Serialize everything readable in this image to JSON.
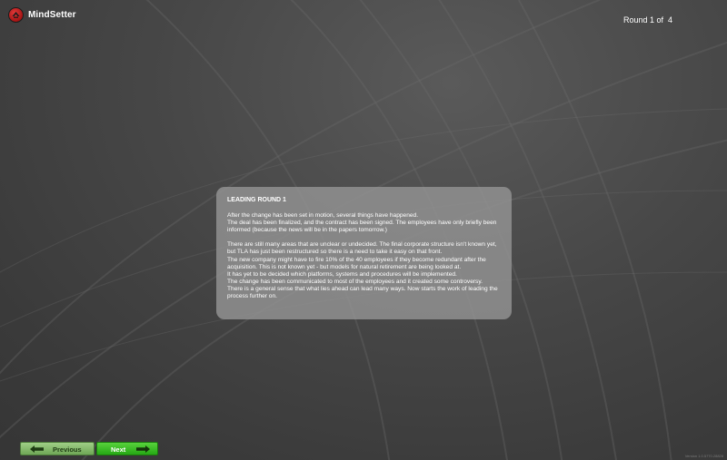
{
  "app": {
    "name": "MindSetter",
    "icon": "mindsetter-logo-icon"
  },
  "round": {
    "text": "Round 1 of  4"
  },
  "panel": {
    "title": "LEADING ROUND 1",
    "para1": "After the change has been set in motion, several things have happened.\nThe deal has been finalized, and the contract has been signed. The employees have only briefly been informed (because the news will be in the papers tomorrow.)",
    "para2": "There are still many areas that are unclear or undecided. The final corporate structure isn't known yet, but TLA has just been restructured so there is a need to take it easy on that front.\nThe new company might have to fire 10% of the 40 employees if they become redundant after the acquisition. This is not known yet - but models for natural retirement are being looked at.\nIt has yet to be decided which platforms, systems and procedures will be implemented.\nThe change has been communicated to most of the employees and it created some controversy.\nThere is a general sense that what lies ahead can lead many ways. Now starts the work of leading the process further on."
  },
  "nav": {
    "previous_label": "Previous",
    "next_label": "Next",
    "previous_icon": "arrow-left-icon",
    "next_icon": "arrow-right-icon"
  },
  "version": {
    "text": "Version 1.0.5770.28828"
  },
  "colors": {
    "background": "#3e3e3e",
    "panel": "#949494",
    "next_button": "#33bb1f",
    "previous_button": "#86bb6c",
    "logo": "#c01f1f"
  }
}
